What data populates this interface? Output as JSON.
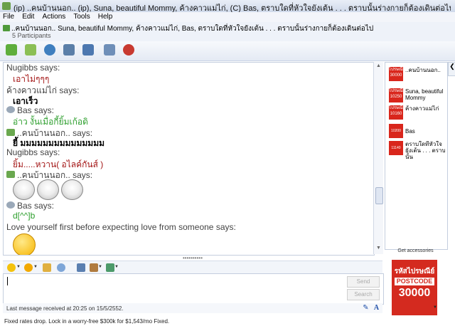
{
  "window": {
    "title": "(ip) ..คนบ้านนอก.. (ip), Suna, beautiful Mommy, ค้างคาวแม่ไก่, (C) Bas, ตราบใดที่หัวใจยังเต้น . . . ตราบนั้นร่างกายก็ต้องเดินต่อไป - Conversation"
  },
  "menu": [
    "File",
    "Edit",
    "Actions",
    "Tools",
    "Help"
  ],
  "participants": {
    "list": "..คนบ้านนอก..  Suna, beautiful Mommy, ค้างคาวแม่ไก่,  Bas, ตราบใดที่หัวใจยังเต้น . . . ตราบนั้นร่างกายก็ต้องเดินต่อไป",
    "count": "5 Participants"
  },
  "toolbar": {
    "icons": [
      "invite-contact-icon",
      "send-files-icon",
      "webcam-icon",
      "call-icon",
      "share-folders-icon",
      "activities-icon",
      "block-icon"
    ]
  },
  "chat": {
    "messages": [
      {
        "sender": "Nugibbs says:",
        "text": "เอาไม่ๆๆๆ",
        "color": "#a31515"
      },
      {
        "sender": "ค้างคาวแม่ไก่ says:",
        "text": "เอาเร็ว",
        "color": "#000000"
      },
      {
        "sender": "Bas says:",
        "text": "อ่าว งั้นเมื่อกี้ยิ้มเก้อดิ",
        "color": "#2c9e2c"
      },
      {
        "sender": "..คนบ้านนอก.. says:",
        "text": "ยี้ มมมมมมมมมมมมมมม",
        "color": "#000000"
      },
      {
        "sender": "Nugibbs says:",
        "text": "ยิ้ม.....หวาน( อไลค์กันส์ )",
        "color": "#a31515"
      },
      {
        "sender": "..คนบ้านนอก.. says:",
        "text": "",
        "color": "#000000"
      },
      {
        "sender": "Bas says:",
        "text": "d[^^]b",
        "color": "#2c9e2c"
      },
      {
        "sender": "Love yourself first before expecting love from someone says:",
        "text": "",
        "color": "#000000"
      }
    ]
  },
  "sidebar": {
    "participants": [
      {
        "name": "..คนบ้านนอก..",
        "badge": "ไปรษณีย์ 30000"
      },
      {
        "name": "Suna, beautiful Mommy",
        "badge": "ไปรษณีย์ 10250"
      },
      {
        "name": "ค้างคาวแม่ไก่",
        "badge": "ไปรษณีย์ 10160"
      },
      {
        "name": "Bas",
        "badge": "10200"
      },
      {
        "name": "ตราบใดที่หัวใจยังเต้น . . . ตราบนั้น",
        "badge": "11140"
      }
    ],
    "get_accessories": "Get accessories",
    "ad": {
      "line1": "รหัสไปรษณีย์",
      "line2": "POSTCODE",
      "line3": "30000"
    }
  },
  "input": {
    "send_label": "Send",
    "search_label": "Search"
  },
  "status": {
    "text": "Last message received at 20:25 on 15/5/2552."
  },
  "banner": {
    "text": "Fixed rates drop. Lock in a worry-free $300k for $1,543/mo Fixed."
  },
  "colors": {
    "accent": "#d42a1f",
    "chrome": "#dfe6f2"
  }
}
